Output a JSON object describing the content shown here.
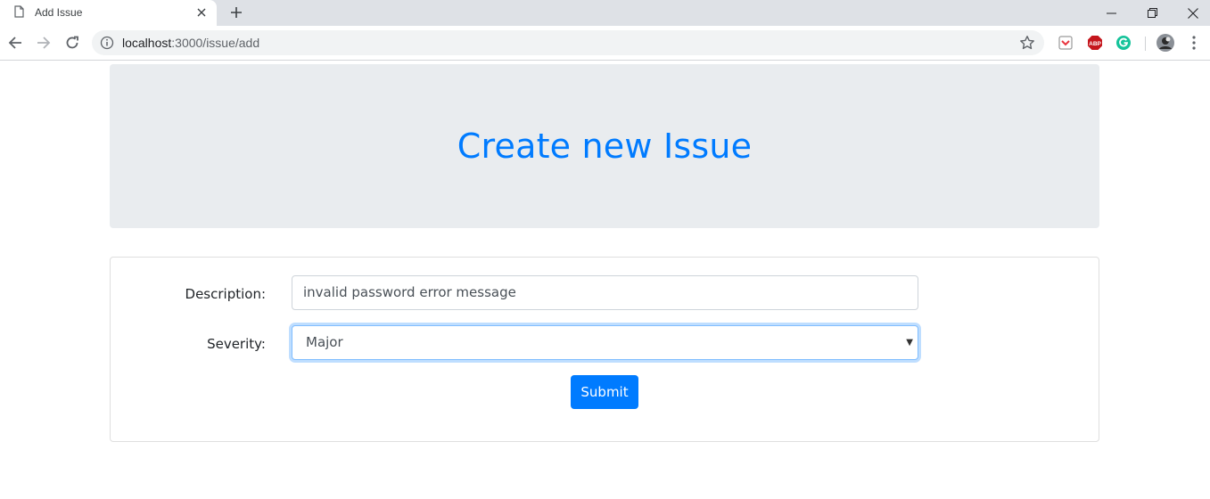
{
  "browser": {
    "tab_title": "Add Issue",
    "url_host": "localhost",
    "url_path": ":3000/issue/add",
    "icons": [
      "page-icon",
      "close-icon",
      "plus-icon",
      "minimize-icon",
      "restore-icon",
      "window-close-icon",
      "back-icon",
      "forward-icon",
      "reload-icon",
      "info-icon",
      "star-icon",
      "pocket-extension-icon",
      "adblock-extension-icon",
      "grammarly-extension-icon",
      "profile-avatar",
      "menu-kebab-icon"
    ],
    "abp_label": "ABP"
  },
  "page": {
    "heading": "Create new Issue",
    "form": {
      "description_label": "Description:",
      "description_value": "invalid password error message",
      "severity_label": "Severity:",
      "severity_value": "Major",
      "submit_label": "Submit"
    }
  },
  "colors": {
    "primary": "#007bff",
    "jumbotron_bg": "#e9ecef",
    "tabstrip_bg": "#dee1e6"
  }
}
